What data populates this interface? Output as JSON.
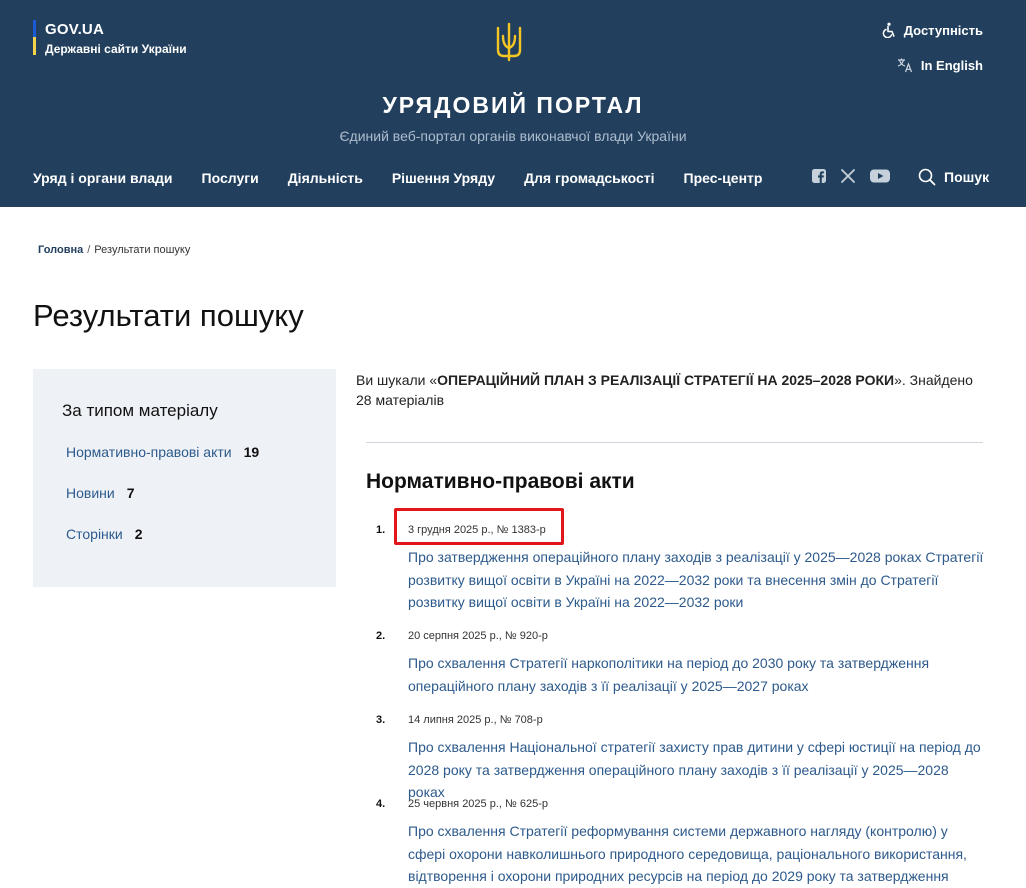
{
  "header": {
    "govua_title": "GOV.UA",
    "govua_subtitle": "Державні сайти України",
    "accessibility_label": "Доступність",
    "language_label": "In English",
    "portal_title": "УРЯДОВИЙ ПОРТАЛ",
    "portal_subtitle": "Єдиний веб-портал органів виконавчої влади України",
    "search_label": "Пошук",
    "nav": [
      {
        "label": "Уряд і органи влади"
      },
      {
        "label": "Послуги"
      },
      {
        "label": "Діяльність"
      },
      {
        "label": "Рішення Уряду"
      },
      {
        "label": "Для громадськості"
      },
      {
        "label": "Прес-центр"
      }
    ],
    "colors": {
      "background": "#22405e",
      "flag_blue": "#1b5bd6",
      "flag_yellow": "#f3d34a"
    }
  },
  "breadcrumb": {
    "home": "Головна",
    "separator": "/",
    "current": "Результати пошуку"
  },
  "page_title": "Результати пошуку",
  "filters": {
    "heading": "За типом матеріалу",
    "items": [
      {
        "label": "Нормативно-правові акти",
        "count": "19"
      },
      {
        "label": "Новини",
        "count": "7"
      },
      {
        "label": "Сторінки",
        "count": "2"
      }
    ]
  },
  "query": {
    "prefix": "Ви шукали «",
    "term": "ОПЕРАЦІЙНИЙ ПЛАН З РЕАЛІЗАЦІЇ СТРАТЕГІЇ НА 2025–2028 РОКИ",
    "suffix": "». Знайдено 28 матеріалів"
  },
  "section_title": "Нормативно-правові акти",
  "results": [
    {
      "num": "1.",
      "meta": "3 грудня 2025 р., № 1383-р",
      "title": "Про затвердження операційного плану заходів з реалізації у 2025—2028 роках Стратегії розвитку вищої освіти в Україні на 2022—2032 роки та внесення змін до Стратегії розвитку вищої освіти в Україні на 2022—2032 роки"
    },
    {
      "num": "2.",
      "meta": "20 серпня 2025 р., № 920-р",
      "title": "Про схвалення Стратегії наркополітики на період до 2030 року та затвердження операційного плану заходів з її реалізації у 2025—2027 роках"
    },
    {
      "num": "3.",
      "meta": "14 липня 2025 р., № 708-р",
      "title": "Про схвалення Національної стратегії захисту прав дитини у сфері юстиції на період до 2028 року та затвердження операційного плану заходів з її реалізації у 2025—2028 роках"
    },
    {
      "num": "4.",
      "meta": "25 червня 2025 р., № 625-р",
      "title": "Про схвалення Стратегії реформування системи державного нагляду (контролю) у сфері охорони навколишнього природного середовища, раціонального використання, відтворення і охорони природних ресурсів на період до 2029 року та затвердження"
    }
  ],
  "highlight_color": "#e0161b"
}
